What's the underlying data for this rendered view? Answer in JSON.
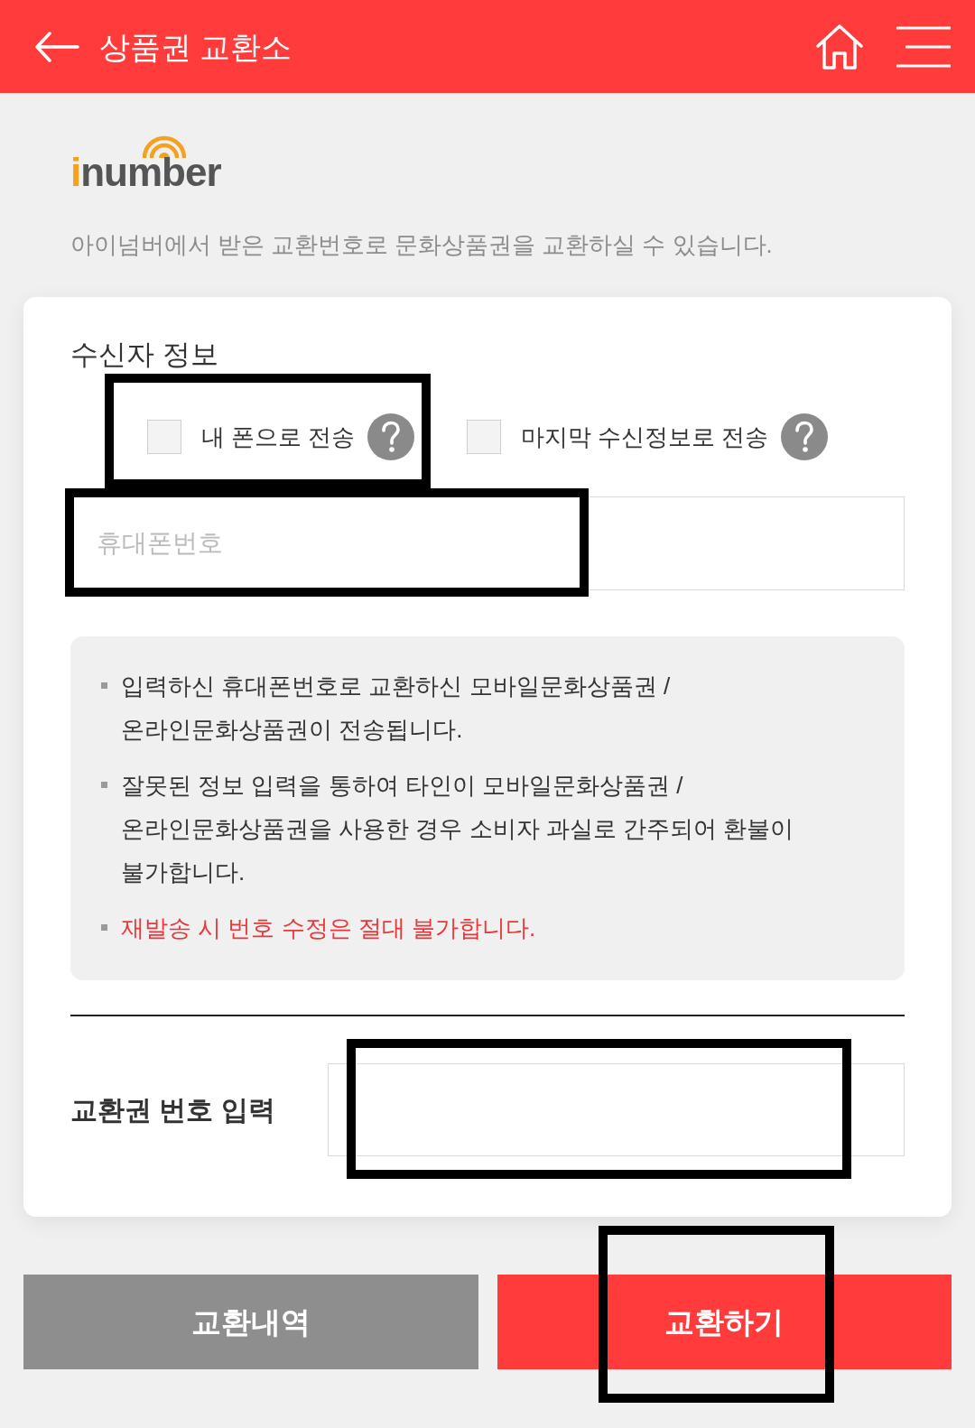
{
  "header": {
    "title": "상품권 교환소"
  },
  "logo": {
    "text": "inumber"
  },
  "intro": "아이넘버에서 받은 교환번호로 문화상품권을 교환하실 수 있습니다.",
  "recipient": {
    "title": "수신자 정보",
    "options": [
      {
        "label": "내 폰으로 전송",
        "checked": false,
        "highlighted": true
      },
      {
        "label": "마지막 수신정보로 전송",
        "checked": false,
        "highlighted": false
      }
    ],
    "phone_field": {
      "placeholder": "휴대폰번호",
      "highlighted": true
    }
  },
  "notices": [
    {
      "kind": "normal",
      "text": "입력하신 휴대폰번호로 교환하신 모바일문화상품권 / 온라인문화상품권이 전송됩니다."
    },
    {
      "kind": "normal",
      "text": "잘못된 정보 입력을 통하여 타인이 모바일문화상품권 / 온라인문화상품권을 사용한 경우 소비자 과실로 간주되어 환불이 불가합니다."
    },
    {
      "kind": "warning",
      "text": "재발송 시 번호 수정은 절대 불가합니다."
    }
  ],
  "code_entry": {
    "label": "교환권 번호 입력",
    "highlighted": true
  },
  "buttons": [
    {
      "kind": "secondary",
      "label": "교환내역",
      "highlighted": false
    },
    {
      "kind": "primary",
      "label": "교환하기",
      "highlighted": true
    }
  ]
}
